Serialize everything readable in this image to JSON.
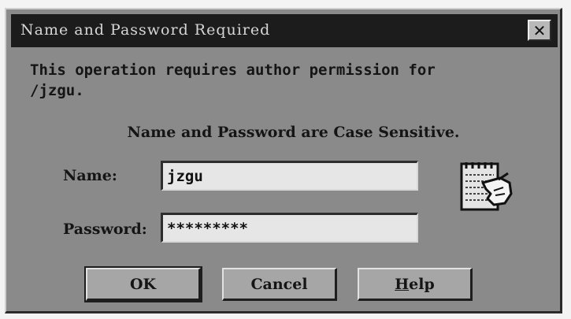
{
  "window": {
    "title": "Name and Password Required",
    "close_glyph": "✕"
  },
  "message": {
    "line1": "This operation requires author permission for",
    "line2": "/jzgu."
  },
  "case_note": "Name and Password are Case Sensitive.",
  "form": {
    "name_label": "Name:",
    "name_value": "jzgu",
    "password_label": "Password:",
    "password_value": "*********"
  },
  "buttons": {
    "ok": "OK",
    "cancel": "Cancel",
    "help_mnemonic": "H",
    "help_rest": "elp"
  },
  "icons": {
    "form": "notepad-hand-icon",
    "close": "close-icon"
  }
}
